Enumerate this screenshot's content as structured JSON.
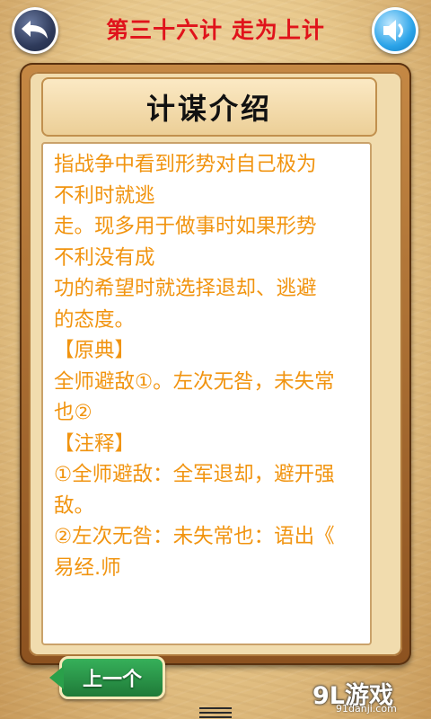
{
  "header": {
    "title": "第三十六计 走为上计",
    "back_icon": "back-arrow-icon",
    "sound_icon": "speaker-icon"
  },
  "section": {
    "title": "计谋介绍"
  },
  "content": {
    "lines": [
      "指战争中看到形势对自己极为",
      "不利时就逃",
      "走。现多用于做事时如果形势",
      "不利没有成",
      "功的希望时就选择退却、逃避",
      "的态度。",
      "【原典】",
      "全师避敌①。左次无咎，未失常",
      "也②",
      "【注释】",
      "①全师避敌：全军退却，避开强",
      "敌。",
      "②左次无咎：未失常也：语出《",
      "易经.师"
    ]
  },
  "footer": {
    "prev_label": "上一个",
    "watermark_main": "9L游戏",
    "watermark_sub": "91danji.com"
  },
  "colors": {
    "title": "#e0131b",
    "content_text": "#f19410",
    "prev_button": "#2a9a48"
  }
}
